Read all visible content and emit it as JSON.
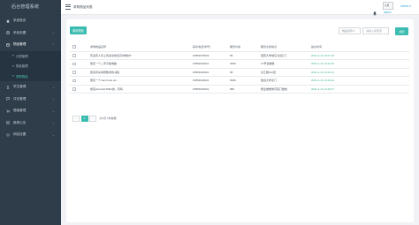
{
  "sidebar": {
    "brand": "后台管理系统",
    "items": [
      {
        "label": "系统首页",
        "icon": "home-icon",
        "expandable": false
      },
      {
        "label": "系统设置",
        "icon": "gear-icon",
        "expandable": true
      },
      {
        "label": "物品管理",
        "icon": "box-icon",
        "expandable": true,
        "open": true,
        "children": [
          {
            "label": "分类管理",
            "active": false
          },
          {
            "label": "物品管理",
            "active": false
          },
          {
            "label": "求购物品",
            "active": true
          }
        ]
      },
      {
        "label": "学生管理",
        "icon": "user-icon",
        "expandable": true
      },
      {
        "label": "评论管理",
        "icon": "comment-icon",
        "expandable": true
      },
      {
        "label": "借租管理",
        "icon": "cart-icon",
        "expandable": true
      },
      {
        "label": "新闻公告",
        "icon": "news-icon",
        "expandable": true
      },
      {
        "label": "网站设置",
        "icon": "settings-icon",
        "expandable": true
      }
    ]
  },
  "header": {
    "title": "求购物品列表",
    "avatar_alt": "头像",
    "avatar_name": "admin",
    "user_menu": "admin ▾"
  },
  "toolbar": {
    "add_label": "新增物品",
    "search_field": "物品名称 ▾",
    "search_placeholder": "请输入搜索值",
    "search_label": "搜索"
  },
  "table": {
    "columns": [
      "求购物品名称",
      "联系电话(学号)",
      "期望价格",
      "期望交易地点",
      "提交时间"
    ],
    "rows": [
      {
        "name": "有没有人手上有多余的初高中教材?",
        "phone": "15854073523",
        "price": "55",
        "place": "西苑大学城东(北区)门",
        "time": "2021-4-11 23:07:18"
      },
      {
        "name": "想买一个二手平板电脑",
        "phone": "15854632921",
        "price": "2699",
        "place": "17号食堂楼",
        "time": "2021-4-11 23:24:40"
      },
      {
        "name": "想买有关考研数学的书籍",
        "phone": "15854632921",
        "price": "58",
        "place": "文汇楼102室",
        "time": "2021-4-11 23:25:14"
      },
      {
        "name": "想买一个mac book pro",
        "phone": "15854632921",
        "price": "5999",
        "place": "致远大学北门",
        "time": "2021-4-11 23:29:22"
      },
      {
        "name": "想买iphone8 256G的，有吗",
        "phone": "15854632921",
        "price": "899",
        "place": "樊业楼楼体育馆门楼前",
        "time": "2021-4-11 23:30:07"
      }
    ]
  },
  "pagination": {
    "prev": "‹",
    "current": "1",
    "next": "›",
    "info": "共1页,5条数据"
  },
  "colors": {
    "accent": "#3bbcb0",
    "sidebar_bg": "#2f3d4a",
    "time_text": "#3fb58a"
  }
}
